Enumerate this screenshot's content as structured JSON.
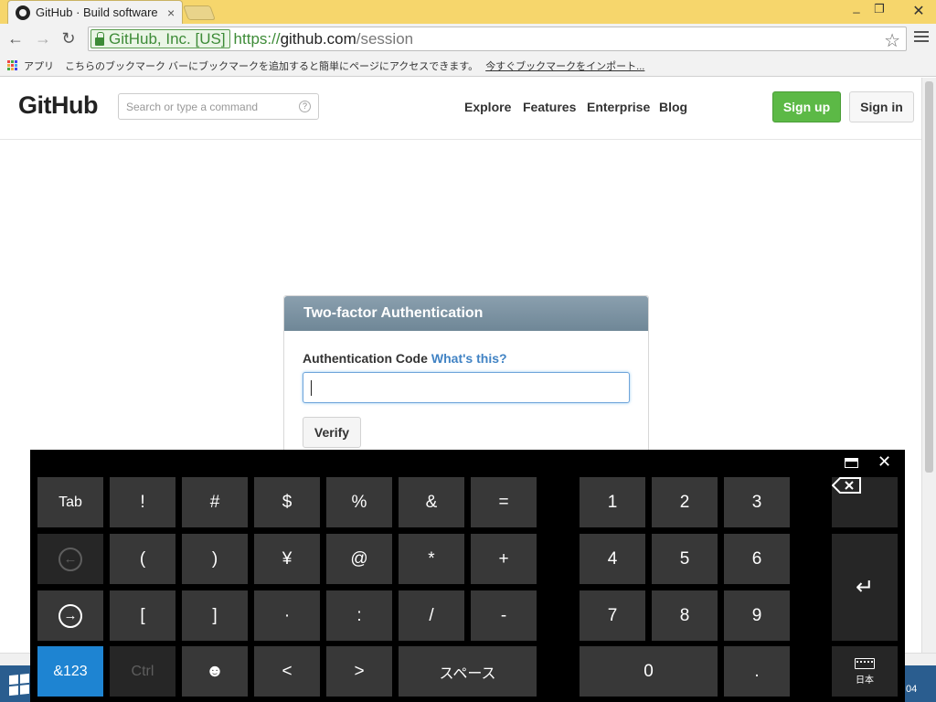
{
  "browser": {
    "tab_title": "GitHub · Build software",
    "tab_close": "×",
    "window_min": "_",
    "window_max": "❐",
    "window_close": "✕",
    "nav_back": "←",
    "nav_forward": "→",
    "nav_reload": "↻",
    "ev_certificate": "GitHub, Inc. [US]",
    "url_scheme": "https://",
    "url_host": "github.com",
    "url_path": "/session",
    "star": "☆"
  },
  "bookmarks": {
    "apps_label": "アプリ",
    "message": "こちらのブックマーク バーにブックマークを追加すると簡単にページにアクセスできます。",
    "import_link": "今すぐブックマークをインポート..."
  },
  "github": {
    "logo": "GitHub",
    "search_placeholder": "Search or type a command",
    "search_help": "?",
    "nav": {
      "explore": "Explore",
      "features": "Features",
      "enterprise": "Enterprise",
      "blog": "Blog"
    },
    "signup": "Sign up",
    "signin": "Sign in",
    "auth": {
      "title": "Two-factor Authentication",
      "label": "Authentication Code",
      "help_link": "What's this?",
      "code_value": "",
      "verify": "Verify"
    }
  },
  "keyboard": {
    "close": "✕",
    "rows": {
      "tab": "Tab",
      "r1": [
        "!",
        "#",
        "$",
        "%",
        "&",
        "="
      ],
      "r2": [
        "(",
        ")",
        "¥",
        "@",
        "*",
        "+"
      ],
      "r3": [
        "[",
        "]",
        "·",
        ":",
        "/",
        "-"
      ],
      "mode": "&123",
      "ctrl": "Ctrl",
      "emoji": "☻",
      "left": "<",
      "right": ">",
      "space": "スペース"
    },
    "numpad": [
      "1",
      "2",
      "3",
      "4",
      "5",
      "6",
      "7",
      "8",
      "9"
    ],
    "zero": "0",
    "dot": ".",
    "enter": "↵",
    "ime_label": "日本",
    "back_arrow": "←",
    "forward_arrow": "→"
  },
  "taskbar": {
    "clock_fragment": "04"
  },
  "colors": {
    "chrome_titlebar": "#f6d66c",
    "signup_green": "#5cb946",
    "link_blue": "#4183c4",
    "keyboard_accent": "#1e84d2"
  }
}
